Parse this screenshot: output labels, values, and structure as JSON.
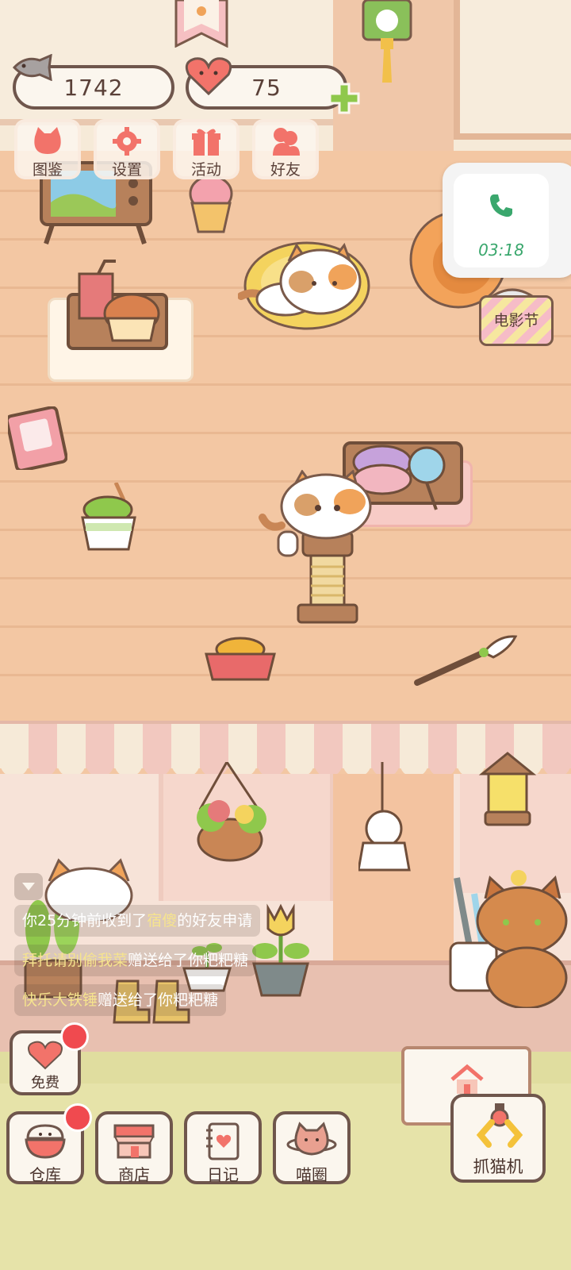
{
  "resources": {
    "fish": {
      "value": "1742",
      "icon": "fish-icon"
    },
    "hearts": {
      "value": "75",
      "icon": "heart-icon",
      "add_icon": "plus-icon"
    }
  },
  "top_menu": [
    {
      "label": "图鉴",
      "icon": "cat-head-icon"
    },
    {
      "label": "设置",
      "icon": "gear-icon"
    },
    {
      "label": "活动",
      "icon": "gift-icon"
    },
    {
      "label": "好友",
      "icon": "friends-icon"
    }
  ],
  "call_notification": {
    "time": "03:18",
    "icon": "phone-icon"
  },
  "movie_sign": {
    "label": "电影节"
  },
  "chat": {
    "messages": [
      {
        "pre": "你25分钟前收到了",
        "name": "宿傻",
        "post": "的好友申请"
      },
      {
        "pre": "",
        "name": "拜托请别偷我菜",
        "post": "赠送给了你粑粑糖"
      },
      {
        "pre": "",
        "name": "快乐大铁锤",
        "post": "赠送给了你粑粑糖"
      }
    ]
  },
  "bottom": {
    "free": {
      "label": "免费",
      "icon": "heart-icon",
      "badge": true
    },
    "buttons": [
      {
        "label": "仓库",
        "icon": "rice-bowl-icon",
        "badge": true
      },
      {
        "label": "商店",
        "icon": "shop-icon",
        "badge": false
      },
      {
        "label": "日记",
        "icon": "diary-icon",
        "badge": false
      },
      {
        "label": "喵圈",
        "icon": "planet-cat-icon",
        "badge": false
      }
    ],
    "claw_machine": {
      "label": "抓猫机",
      "icon": "claw-icon"
    },
    "home_sign": {
      "icon": "house-icon"
    }
  },
  "colors": {
    "outline": "#6f564c",
    "badge": "#f04a4f",
    "accent_green": "#8fc84c",
    "heart_pink": "#f2736a",
    "chat_highlight": "#f6e48e"
  }
}
